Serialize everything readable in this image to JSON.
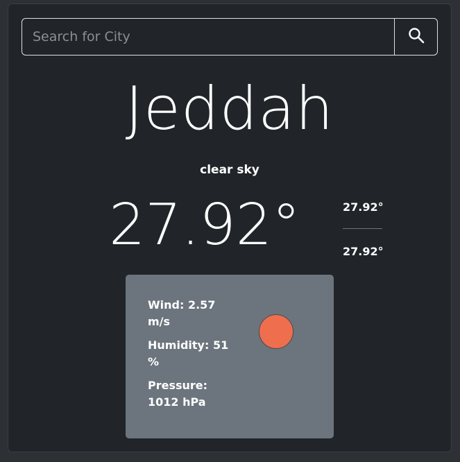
{
  "search": {
    "placeholder": "Search for City",
    "value": ""
  },
  "weather": {
    "city": "Jeddah",
    "description": "clear sky",
    "temperature": "27.92°",
    "temp_max": "27.92°",
    "temp_min": "27.92°"
  },
  "details": {
    "wind_label": "Wind:",
    "wind_value": "2.57 m/s",
    "humidity_label": "Humidity:",
    "humidity_value": "51 %",
    "pressure_label": "Pressure:",
    "pressure_value": "1012 hPa"
  },
  "icons": {
    "search": "search-icon",
    "indicator": "weather-indicator-dot"
  },
  "colors": {
    "background": "#212529",
    "panel": "#6c757d",
    "indicator": "#ee6e4e",
    "text": "#ffffff"
  }
}
